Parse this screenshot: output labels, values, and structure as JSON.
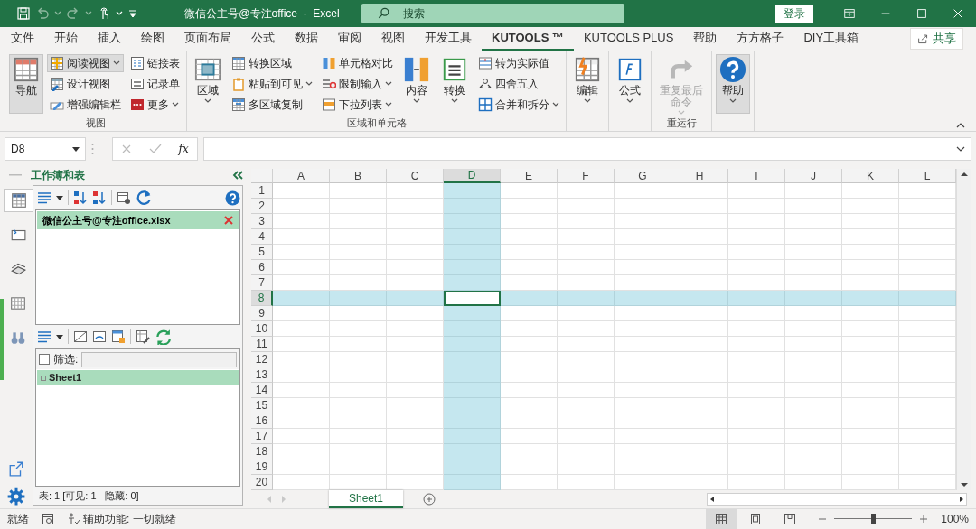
{
  "title_bar": {
    "title": "微信公主号@专注office  -  Excel",
    "search_placeholder": "搜索",
    "sign_in": "登录"
  },
  "menu_tabs": [
    {
      "label": "文件",
      "selected": false
    },
    {
      "label": "开始",
      "selected": false
    },
    {
      "label": "插入",
      "selected": false
    },
    {
      "label": "绘图",
      "selected": false
    },
    {
      "label": "页面布局",
      "selected": false
    },
    {
      "label": "公式",
      "selected": false
    },
    {
      "label": "数据",
      "selected": false
    },
    {
      "label": "审阅",
      "selected": false
    },
    {
      "label": "视图",
      "selected": false
    },
    {
      "label": "开发工具",
      "selected": false
    },
    {
      "label": "KUTOOLS ™",
      "selected": true
    },
    {
      "label": "KUTOOLS PLUS",
      "selected": false
    },
    {
      "label": "帮助",
      "selected": false
    },
    {
      "label": "方方格子",
      "selected": false
    },
    {
      "label": "DIY工具箱",
      "selected": false
    }
  ],
  "share_button": "共享",
  "ribbon": {
    "groups": [
      {
        "label": "视图",
        "columns": [
          [
            {
              "label": "导航",
              "kind": "large",
              "selected": true,
              "dropdown": false,
              "disabled": false
            }
          ],
          [
            {
              "label": "阅读视图",
              "kind": "small",
              "selected": true,
              "dropdown": true,
              "disabled": false
            },
            {
              "label": "设计视图",
              "kind": "small",
              "selected": false,
              "dropdown": false,
              "disabled": false
            },
            {
              "label": "增强编辑栏",
              "kind": "small",
              "selected": false,
              "dropdown": false,
              "disabled": false
            }
          ],
          [
            {
              "label": "链接表",
              "kind": "small",
              "selected": false,
              "dropdown": false,
              "disabled": false
            },
            {
              "label": "记录单",
              "kind": "small",
              "selected": false,
              "dropdown": false,
              "disabled": false
            },
            {
              "label": "更多",
              "kind": "small",
              "selected": false,
              "dropdown": true,
              "disabled": false
            }
          ]
        ]
      },
      {
        "label": "区域和单元格",
        "columns": [
          [
            {
              "label": "区域",
              "kind": "large",
              "selected": false,
              "dropdown": true,
              "disabled": false
            }
          ],
          [
            {
              "label": "转换区域",
              "kind": "small",
              "selected": false,
              "dropdown": false,
              "disabled": false
            },
            {
              "label": "粘贴到可见",
              "kind": "small",
              "selected": false,
              "dropdown": true,
              "disabled": false
            },
            {
              "label": "多区域复制",
              "kind": "small",
              "selected": false,
              "dropdown": false,
              "disabled": false
            }
          ],
          [
            {
              "label": "单元格对比",
              "kind": "small",
              "selected": false,
              "dropdown": false,
              "disabled": false
            },
            {
              "label": "限制输入",
              "kind": "small",
              "selected": false,
              "dropdown": true,
              "disabled": false
            },
            {
              "label": "下拉列表",
              "kind": "small",
              "selected": false,
              "dropdown": true,
              "disabled": false
            }
          ],
          [
            {
              "label": "内容",
              "kind": "large",
              "selected": false,
              "dropdown": true,
              "disabled": false
            }
          ],
          [
            {
              "label": "转换",
              "kind": "large",
              "selected": false,
              "dropdown": true,
              "disabled": false
            }
          ],
          [
            {
              "label": "转为实际值",
              "kind": "small",
              "selected": false,
              "dropdown": false,
              "disabled": false
            },
            {
              "label": "四舍五入",
              "kind": "small",
              "selected": false,
              "dropdown": false,
              "disabled": false
            },
            {
              "label": "合并和拆分",
              "kind": "small",
              "selected": false,
              "dropdown": true,
              "disabled": false
            }
          ]
        ]
      },
      {
        "columns": [
          [
            {
              "label": "编辑",
              "kind": "large",
              "selected": false,
              "dropdown": true,
              "disabled": false
            }
          ]
        ]
      },
      {
        "columns": [
          [
            {
              "label": "公式",
              "kind": "large",
              "selected": false,
              "dropdown": true,
              "disabled": false
            }
          ]
        ]
      },
      {
        "label": "重运行",
        "columns": [
          [
            {
              "label": "重复最后命令",
              "kind": "large",
              "selected": false,
              "dropdown": true,
              "disabled": true
            }
          ]
        ]
      },
      {
        "columns": [
          [
            {
              "label": "帮助",
              "kind": "large",
              "selected": true,
              "dropdown": true,
              "disabled": false
            }
          ]
        ]
      }
    ]
  },
  "formula_bar": {
    "name_box": "D8",
    "function_label": "fx"
  },
  "pane": {
    "title": "工作簿和表",
    "tabs": [
      {
        "selected": true
      },
      {
        "selected": false
      },
      {
        "selected": false
      },
      {
        "selected": false
      },
      {
        "selected": false
      }
    ],
    "workbooks": [
      {
        "label": "微信公主号@专注office.xlsx",
        "selected": true
      }
    ],
    "filter": {
      "label": "筛选:",
      "checked": false
    },
    "sheets": [
      {
        "label": "Sheet1",
        "selected": true
      }
    ],
    "summary": "表: 1  [可见: 1 - 隐藏: 0]"
  },
  "grid": {
    "columns": [
      {
        "label": "A",
        "selected": false
      },
      {
        "label": "B",
        "selected": false
      },
      {
        "label": "C",
        "selected": false
      },
      {
        "label": "D",
        "selected": true
      },
      {
        "label": "E",
        "selected": false
      },
      {
        "label": "F",
        "selected": false
      },
      {
        "label": "G",
        "selected": false
      },
      {
        "label": "H",
        "selected": false
      },
      {
        "label": "I",
        "selected": false
      },
      {
        "label": "J",
        "selected": false
      },
      {
        "label": "K",
        "selected": false
      },
      {
        "label": "L",
        "selected": false
      }
    ],
    "rows": [
      {
        "label": "1",
        "selected": false
      },
      {
        "label": "2",
        "selected": false
      },
      {
        "label": "3",
        "selected": false
      },
      {
        "label": "4",
        "selected": false
      },
      {
        "label": "5",
        "selected": false
      },
      {
        "label": "6",
        "selected": false
      },
      {
        "label": "7",
        "selected": false
      },
      {
        "label": "8",
        "selected": true
      },
      {
        "label": "9",
        "selected": false
      },
      {
        "label": "10",
        "selected": false
      },
      {
        "label": "11",
        "selected": false
      },
      {
        "label": "12",
        "selected": false
      },
      {
        "label": "13",
        "selected": false
      },
      {
        "label": "14",
        "selected": false
      },
      {
        "label": "15",
        "selected": false
      },
      {
        "label": "16",
        "selected": false
      },
      {
        "label": "17",
        "selected": false
      },
      {
        "label": "18",
        "selected": false
      },
      {
        "label": "19",
        "selected": false
      },
      {
        "label": "20",
        "selected": false
      }
    ]
  },
  "sheet_tabs": [
    {
      "label": "Sheet1",
      "selected": true
    }
  ],
  "status_bar": {
    "ready": "就绪",
    "accessibility": "辅助功能: 一切就绪",
    "views": [
      {
        "selected": true
      },
      {
        "selected": false
      },
      {
        "selected": false
      }
    ],
    "zoom": {
      "level": 0.5,
      "reading": "100%"
    }
  }
}
